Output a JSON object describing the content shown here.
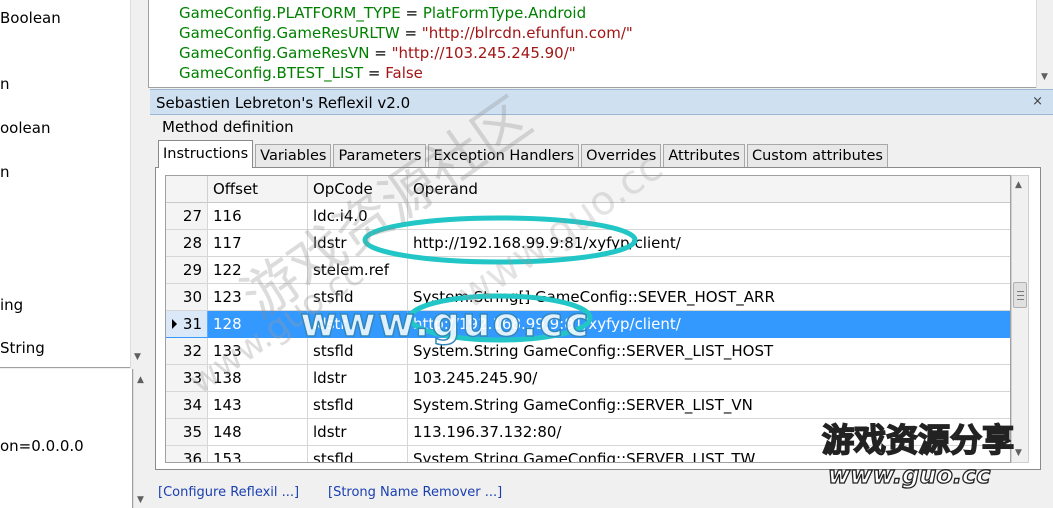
{
  "left_tree": {
    "items": [
      "Boolean",
      "n",
      "oolean",
      "n",
      "ing",
      "String",
      "on=0.0.0.0"
    ]
  },
  "code": {
    "lines": [
      {
        "ident": "GameConfig.PLATFORM_TYPE",
        "op": " = ",
        "value": "PlatFormType.Android",
        "value_kind": "ident"
      },
      {
        "ident": "GameConfig.GameResURLTW",
        "op": " = ",
        "value": "\"http://blrcdn.efunfun.com/\"",
        "value_kind": "string"
      },
      {
        "ident": "GameConfig.GameResVN",
        "op": " = ",
        "value": "\"http://103.245.245.90/\"",
        "value_kind": "string"
      },
      {
        "ident": "GameConfig.BTEST_LIST",
        "op": " = ",
        "value": "False",
        "value_kind": "string"
      }
    ]
  },
  "reflexil": {
    "title": "Sebastien Lebreton's Reflexil v2.0",
    "close_label": "×",
    "method_definition_label": "Method definition",
    "tabs": [
      "Instructions",
      "Variables",
      "Parameters",
      "Exception Handlers",
      "Overrides",
      "Attributes",
      "Custom attributes"
    ],
    "active_tab": 0,
    "grid": {
      "columns": [
        "Offset",
        "OpCode",
        "Operand"
      ],
      "rows": [
        {
          "index": "27",
          "offset": "116",
          "opcode": "ldc.i4.0",
          "operand": ""
        },
        {
          "index": "28",
          "offset": "117",
          "opcode": "ldstr",
          "operand": "http://192.168.99.9:81/xyfyp/client/"
        },
        {
          "index": "29",
          "offset": "122",
          "opcode": "stelem.ref",
          "operand": ""
        },
        {
          "index": "30",
          "offset": "123",
          "opcode": "stsfld",
          "operand": "System.String[] GameConfig::SEVER_HOST_ARR"
        },
        {
          "index": "31",
          "offset": "128",
          "opcode": "ldstr",
          "operand": "http://192.168.99.9:81/xyfyp/client/"
        },
        {
          "index": "32",
          "offset": "133",
          "opcode": "stsfld",
          "operand": "System.String GameConfig::SERVER_LIST_HOST"
        },
        {
          "index": "33",
          "offset": "138",
          "opcode": "ldstr",
          "operand": "103.245.245.90/"
        },
        {
          "index": "34",
          "offset": "143",
          "opcode": "stsfld",
          "operand": "System.String GameConfig::SERVER_LIST_VN"
        },
        {
          "index": "35",
          "offset": "148",
          "opcode": "ldstr",
          "operand": "113.196.37.132:80/"
        },
        {
          "index": "36",
          "offset": "153",
          "opcode": "stsfld",
          "operand": "System.String GameConfig::SERVER_LIST_TW"
        }
      ],
      "selected_row": 4
    },
    "links": {
      "configure": "[Configure Reflexil ...]",
      "strong_name": "[Strong Name Remover ...]"
    }
  },
  "watermark": {
    "site_name": "游戏资源分享",
    "site_url": "www.guo.cc",
    "diag_text": "游戏资源社区",
    "diag_url": "www.guo.cc",
    "center_url": "www.guo.cc"
  },
  "colors": {
    "code_ident": "#008000",
    "code_string": "#a31515",
    "selection": "#3399ff",
    "highlight_ring": "#22c6c6",
    "link": "#1a3fb0"
  }
}
